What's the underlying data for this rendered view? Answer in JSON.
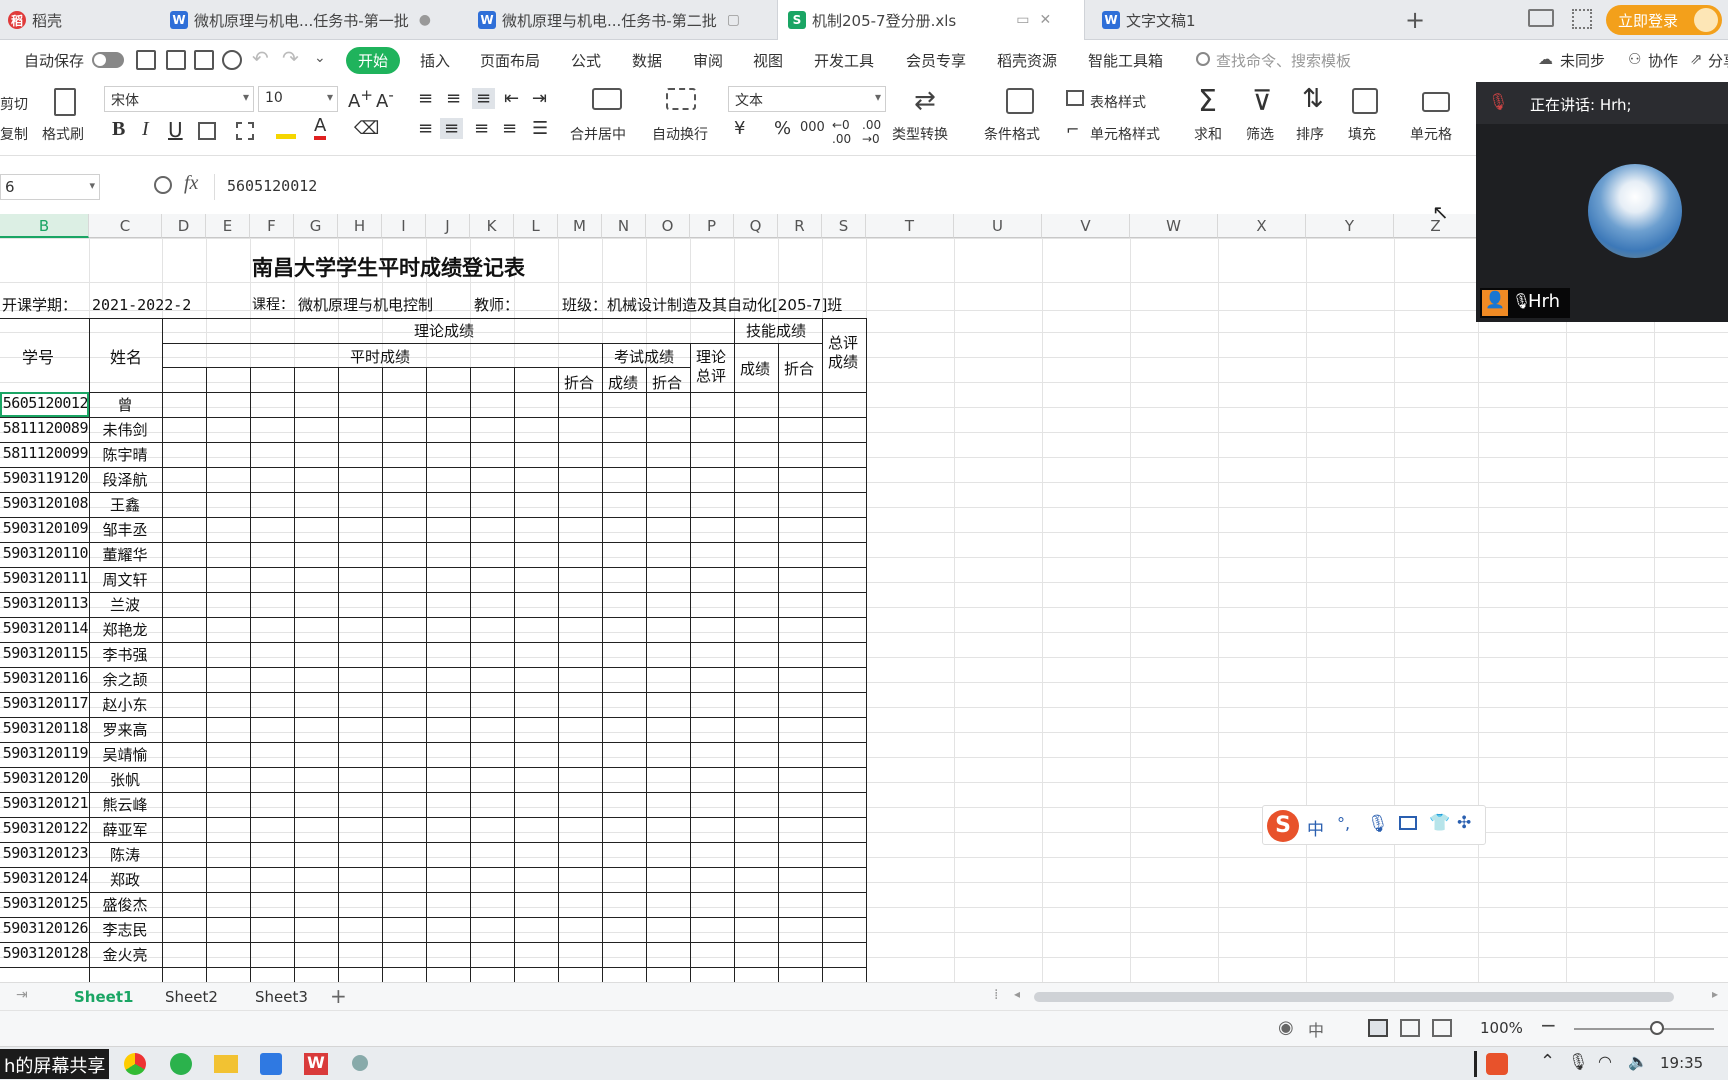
{
  "tabs": [
    {
      "label": "稻壳",
      "icon": "daoke-logo-icon"
    },
    {
      "label": "微机原理与机电...任务书-第一批",
      "icon": "word-doc-icon"
    },
    {
      "label": "微机原理与机电...任务书-第二批",
      "icon": "word-doc-icon"
    },
    {
      "label": "机制205-7登分册.xls",
      "icon": "sheet-doc-icon",
      "active": true
    },
    {
      "label": "文字文稿1",
      "icon": "word-doc-icon"
    }
  ],
  "tabbar": {
    "new_tab": "+",
    "login": "立即登录"
  },
  "menu": {
    "autosave": "自动保存",
    "items": [
      "开始",
      "插入",
      "页面布局",
      "公式",
      "数据",
      "审阅",
      "视图",
      "开发工具",
      "会员专享",
      "稻壳资源",
      "智能工具箱"
    ],
    "search": "查找命令、搜索模板",
    "unsynced": "未同步",
    "collab": "协作",
    "share": "分享"
  },
  "ribbon": {
    "cut": "剪切",
    "copy": "复制",
    "format_painter": "格式刷",
    "font": "宋体",
    "font_size": "10",
    "merge": "合并居中",
    "wrap": "自动换行",
    "numfmt": "文本",
    "type_convert": "类型转换",
    "cond_format": "条件格式",
    "table_style": "表格样式",
    "cell_style": "单元格样式",
    "sum": "求和",
    "filter": "筛选",
    "sort": "排序",
    "fill": "填充",
    "cells": "单元格",
    "bold": "B",
    "italic": "I",
    "underline": "U",
    "currency": "¥",
    "percent": "%",
    "thousands": "000"
  },
  "formula_bar": {
    "cell_ref": "6",
    "fx": "fx",
    "value": "5605120012"
  },
  "columns": [
    "B",
    "C",
    "D",
    "E",
    "F",
    "G",
    "H",
    "I",
    "J",
    "K",
    "L",
    "M",
    "N",
    "O",
    "P",
    "Q",
    "R",
    "S",
    "T",
    "U",
    "V",
    "W",
    "X",
    "Y",
    "Z"
  ],
  "sheet": {
    "title": "南昌大学学生平时成绩登记表",
    "term_label": "开课学期：",
    "term_value": "2021-2022-2",
    "course_label": "课程：",
    "course_value": "微机原理与机电控制",
    "teacher_label": "教师：",
    "class_label": "班级：机械设计制造及其自动化[205-7]班",
    "h_id": "学号",
    "h_name": "姓名",
    "h_theory": "理论成绩",
    "h_skill": "技能成绩",
    "h_total": "总评成绩",
    "h_usual": "平时成绩",
    "h_exam": "考试成绩",
    "h_theory_total": "理论总评",
    "h_zhehe": "折合",
    "h_score": "成绩",
    "h_zhehe2": "折合",
    "h_skill_score": "成绩",
    "h_skill_zhehe": "折合",
    "students": [
      {
        "id": "5605120012",
        "name": "曾"
      },
      {
        "id": "5811120089",
        "name": "未伟剑"
      },
      {
        "id": "5811120099",
        "name": "陈宇晴"
      },
      {
        "id": "5903119120",
        "name": "段泽航"
      },
      {
        "id": "5903120108",
        "name": "王鑫"
      },
      {
        "id": "5903120109",
        "name": "邹丰丞"
      },
      {
        "id": "5903120110",
        "name": "董耀华"
      },
      {
        "id": "5903120111",
        "name": "周文轩"
      },
      {
        "id": "5903120113",
        "name": "兰波"
      },
      {
        "id": "5903120114",
        "name": "郑艳龙"
      },
      {
        "id": "5903120115",
        "name": "李书强"
      },
      {
        "id": "5903120116",
        "name": "余之颉"
      },
      {
        "id": "5903120117",
        "name": "赵小东"
      },
      {
        "id": "5903120118",
        "name": "罗来高"
      },
      {
        "id": "5903120119",
        "name": "吴靖愉"
      },
      {
        "id": "5903120120",
        "name": "张帆"
      },
      {
        "id": "5903120121",
        "name": "熊云峰"
      },
      {
        "id": "5903120122",
        "name": "薛亚军"
      },
      {
        "id": "5903120123",
        "name": "陈涛"
      },
      {
        "id": "5903120124",
        "name": "郑政"
      },
      {
        "id": "5903120125",
        "name": "盛俊杰"
      },
      {
        "id": "5903120126",
        "name": "李志民"
      },
      {
        "id": "5903120128",
        "name": "金火亮"
      }
    ]
  },
  "sheets": [
    "Sheet1",
    "Sheet2",
    "Sheet3"
  ],
  "status": {
    "zoom": "100%"
  },
  "video": {
    "speaking": "正在讲话: Hrh;",
    "user": "Hrh"
  },
  "ime": {
    "mode": "中",
    "punct": "°,"
  },
  "taskbar": {
    "share_label": "h的屏幕共享",
    "time": "19:35"
  }
}
